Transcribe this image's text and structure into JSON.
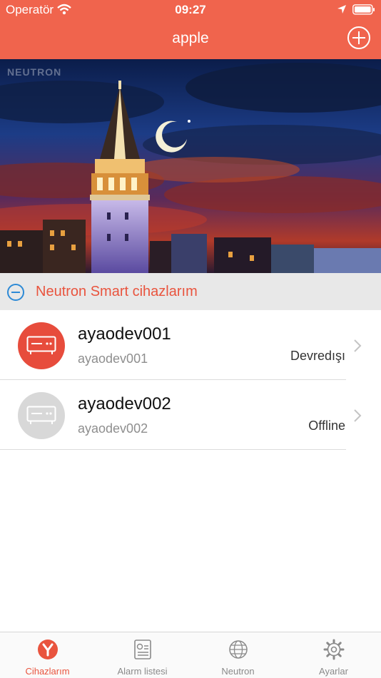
{
  "status_bar": {
    "carrier": "Operatör",
    "time": "09:27"
  },
  "header": {
    "title": "apple"
  },
  "banner": {
    "watermark": "NEUTRON"
  },
  "section": {
    "title": "Neutron Smart cihazlarım"
  },
  "devices": [
    {
      "name": "ayaodev001",
      "subtitle": "ayaodev001",
      "status": "Devredışı",
      "icon_color": "#e74c3c"
    },
    {
      "name": "ayaodev002",
      "subtitle": "ayaodev002",
      "status": "Offline",
      "icon_color": "#d8d8d8"
    }
  ],
  "tabs": [
    {
      "label": "Cihazlarım",
      "icon": "devices-icon",
      "active": true
    },
    {
      "label": "Alarm listesi",
      "icon": "alarm-list-icon",
      "active": false
    },
    {
      "label": "Neutron",
      "icon": "globe-icon",
      "active": false
    },
    {
      "label": "Ayarlar",
      "icon": "gear-icon",
      "active": false
    }
  ],
  "colors": {
    "accent": "#f0644d",
    "accent_text": "#e9543e",
    "section_bg": "#e8e8e8"
  }
}
